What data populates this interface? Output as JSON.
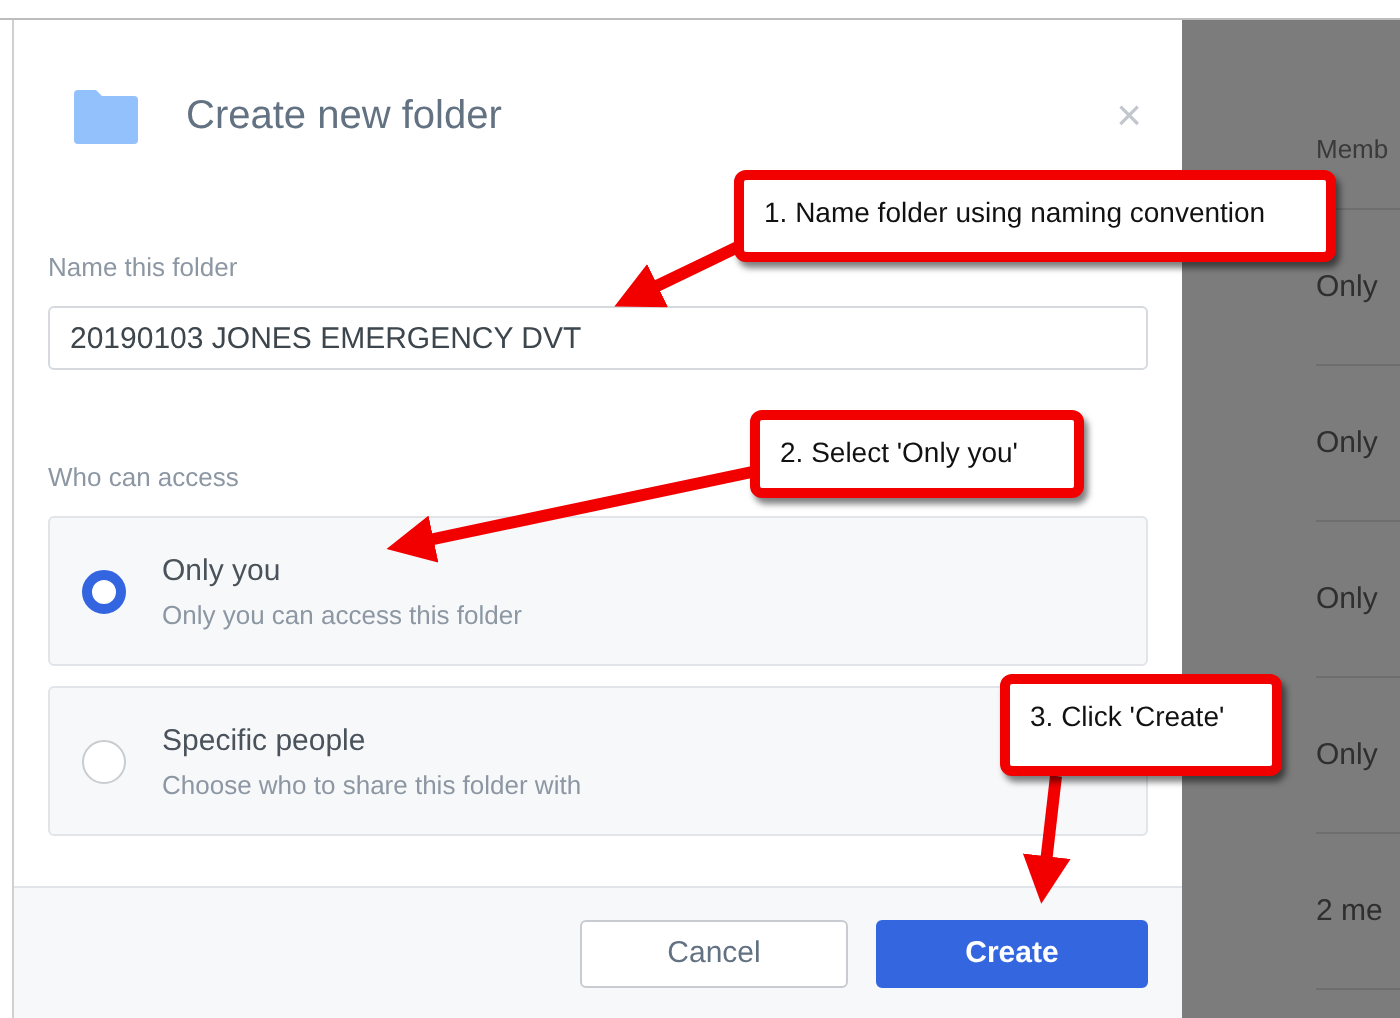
{
  "dialog": {
    "title": "Create new folder",
    "close": "×",
    "name_label": "Name this folder",
    "name_value": "20190103 JONES EMERGENCY DVT",
    "access_label": "Who can access",
    "options": [
      {
        "label": "Only you",
        "description": "Only you can access this folder",
        "selected": true
      },
      {
        "label": "Specific people",
        "description": "Choose who to share this folder with",
        "selected": false
      }
    ],
    "buttons": [
      {
        "label": "Cancel",
        "kind": "secondary"
      },
      {
        "label": "Create",
        "kind": "primary"
      }
    ]
  },
  "background_list": {
    "header": "Memb",
    "rows": [
      "Only",
      "Only",
      "Only",
      "Only",
      "2 me"
    ]
  },
  "callouts": [
    {
      "text": "1. Name folder using naming convention"
    },
    {
      "text": "2. Select 'Only you'"
    },
    {
      "text": "3. Click 'Create'"
    }
  ]
}
